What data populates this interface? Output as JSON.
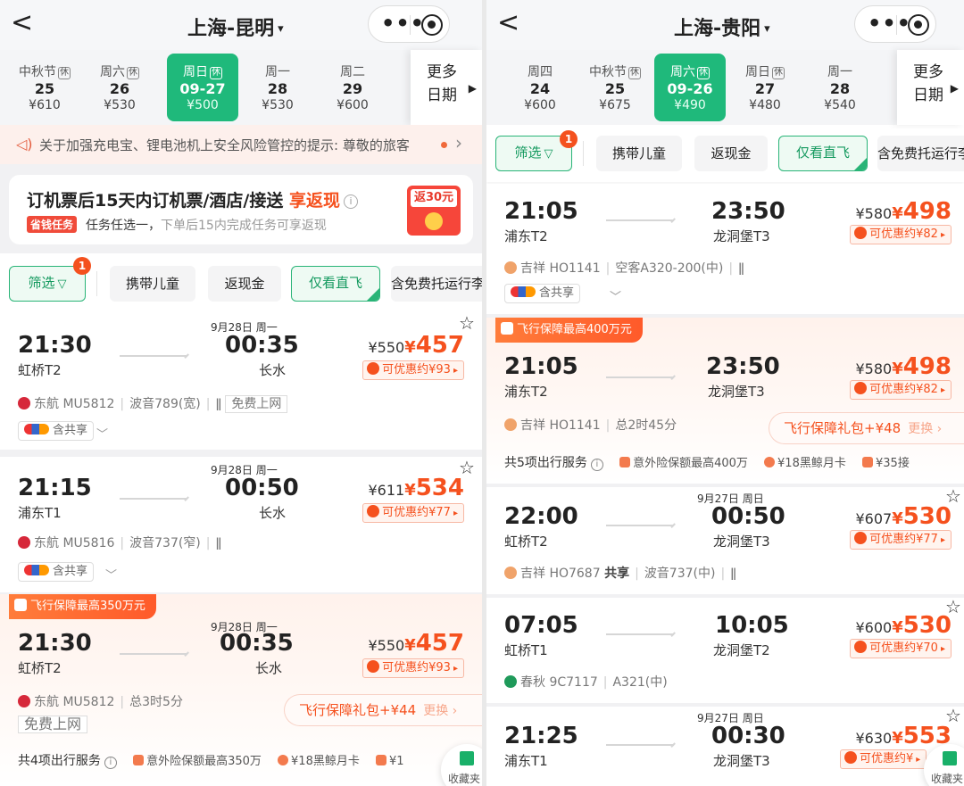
{
  "left": {
    "back_glyph": "<",
    "route": "上海-昆明",
    "route_arrow": "▾",
    "dates": [
      {
        "week": "中秋节",
        "tag": "休",
        "day": "25",
        "price": "¥610",
        "selected": false
      },
      {
        "week": "周六",
        "tag": "休",
        "day": "26",
        "price": "¥530",
        "selected": false
      },
      {
        "week": "周日",
        "tag": "休",
        "day": "09-27",
        "price": "¥500",
        "selected": true
      },
      {
        "week": "周一",
        "tag": "",
        "day": "28",
        "price": "¥530",
        "selected": false
      },
      {
        "week": "周二",
        "tag": "",
        "day": "29",
        "price": "¥600",
        "selected": false
      }
    ],
    "more_dates": [
      "更多",
      "日期"
    ],
    "notice": "关于加强充电宝、锂电池机上安全风险管控的提示: 尊敬的旅客",
    "promo": {
      "title": "订机票后15天内订机票/酒店/接送",
      "highlight": "享返现",
      "badge": "省钱任务",
      "sub": "任务任选一，",
      "sub_muted": "下单后15内完成任务可享返现",
      "packet": "返30元"
    },
    "filters": {
      "filter": "筛选",
      "badge": "1",
      "child": "携带儿童",
      "cashback": "返现金",
      "direct": "仅看直飞",
      "baggage": "含免费托运行李"
    },
    "flights": [
      {
        "dep": "21:30",
        "dep_ap": "虹桥T2",
        "arr": "00:35",
        "arr_ap": "长水",
        "next": "9月28日 周一",
        "old": "¥550",
        "sym": "¥",
        "price": "457",
        "save": "可优惠约¥93",
        "airline": "东航 MU5812",
        "aircraft": "波音789(宽)",
        "extra": "免费上网",
        "share": "含共享"
      },
      {
        "dep": "21:15",
        "dep_ap": "浦东T1",
        "arr": "00:50",
        "arr_ap": "长水",
        "next": "9月28日 周一",
        "old": "¥611",
        "sym": "¥",
        "price": "534",
        "save": "可优惠约¥77",
        "airline": "东航 MU5816",
        "aircraft": "波音737(窄)",
        "share": "含共享"
      },
      {
        "tag": "飞行保障最高350万元",
        "dep": "21:30",
        "dep_ap": "虹桥T2",
        "arr": "00:35",
        "arr_ap": "长水",
        "next": "9月28日 周一",
        "old": "¥550",
        "sym": "¥",
        "price": "457",
        "save": "可优惠约¥93",
        "airline": "东航 MU5812",
        "duration": "总3时5分",
        "extra": "免费上网",
        "package": "飞行保障礼包+¥44",
        "swap": "更换 ›",
        "services_head": "共4项出行服务",
        "services": [
          "意外险保额最高350万",
          "¥18黑鲸月卡",
          "¥1"
        ]
      }
    ],
    "fav": "收藏夹"
  },
  "right": {
    "back_glyph": "<",
    "route": "上海-贵阳",
    "route_arrow": "▾",
    "dates": [
      {
        "week": "周四",
        "tag": "",
        "day": "24",
        "price": "¥600",
        "selected": false
      },
      {
        "week": "中秋节",
        "tag": "休",
        "day": "25",
        "price": "¥675",
        "selected": false
      },
      {
        "week": "周六",
        "tag": "休",
        "day": "09-26",
        "price": "¥490",
        "selected": true
      },
      {
        "week": "周日",
        "tag": "休",
        "day": "27",
        "price": "¥480",
        "selected": false
      },
      {
        "week": "周一",
        "tag": "",
        "day": "28",
        "price": "¥540",
        "selected": false
      }
    ],
    "more_dates": [
      "更多",
      "日期"
    ],
    "filters": {
      "filter": "筛选",
      "badge": "1",
      "child": "携带儿童",
      "cashback": "返现金",
      "direct": "仅看直飞",
      "baggage": "含免费托运行李"
    },
    "flights": [
      {
        "dep": "21:05",
        "dep_ap": "浦东T2",
        "arr": "23:50",
        "arr_ap": "龙洞堡T3",
        "old": "¥580",
        "sym": "¥",
        "price": "498",
        "save": "可优惠约¥82",
        "airline": "吉祥 HO1141",
        "aircraft": "空客A320-200(中)",
        "share": "含共享"
      },
      {
        "tag": "飞行保障最高400万元",
        "dep": "21:05",
        "dep_ap": "浦东T2",
        "arr": "23:50",
        "arr_ap": "龙洞堡T3",
        "old": "¥580",
        "sym": "¥",
        "price": "498",
        "save": "可优惠约¥82",
        "airline": "吉祥 HO1141",
        "duration": "总2时45分",
        "package": "飞行保障礼包+¥48",
        "swap": "更换 ›",
        "services_head": "共5项出行服务",
        "services": [
          "意外险保额最高400万",
          "¥18黑鲸月卡",
          "¥35接"
        ]
      },
      {
        "dep": "22:00",
        "dep_ap": "虹桥T2",
        "arr": "00:50",
        "arr_ap": "龙洞堡T3",
        "next": "9月27日 周日",
        "old": "¥607",
        "sym": "¥",
        "price": "530",
        "save": "可优惠约¥77",
        "airline": "吉祥 HO7687",
        "shared_flag": "共享",
        "aircraft": "波音737(中)"
      },
      {
        "dep": "07:05",
        "dep_ap": "虹桥T1",
        "arr": "10:05",
        "arr_ap": "龙洞堡T2",
        "old": "¥600",
        "sym": "¥",
        "price": "530",
        "save": "可优惠约¥70",
        "airline": "春秋 9C7117",
        "aircraft": "A321(中)"
      },
      {
        "dep": "21:25",
        "dep_ap": "浦东T1",
        "arr": "00:30",
        "arr_ap": "龙洞堡T3",
        "next": "9月27日 周日",
        "old": "¥630",
        "sym": "¥",
        "price": "553",
        "save": "可优惠约¥"
      }
    ],
    "fav": "收藏夹"
  },
  "icons": {
    "star": "☆",
    "meal": "meal-icon",
    "info": "i",
    "speaker": "speaker-icon"
  },
  "colors": {
    "accent_green": "#1fb97b",
    "price_orange": "#f5511e",
    "eastern_red": "#d6283a",
    "juneyao_orange": "#f0a36a",
    "spring_green": "#1f9a5a"
  }
}
